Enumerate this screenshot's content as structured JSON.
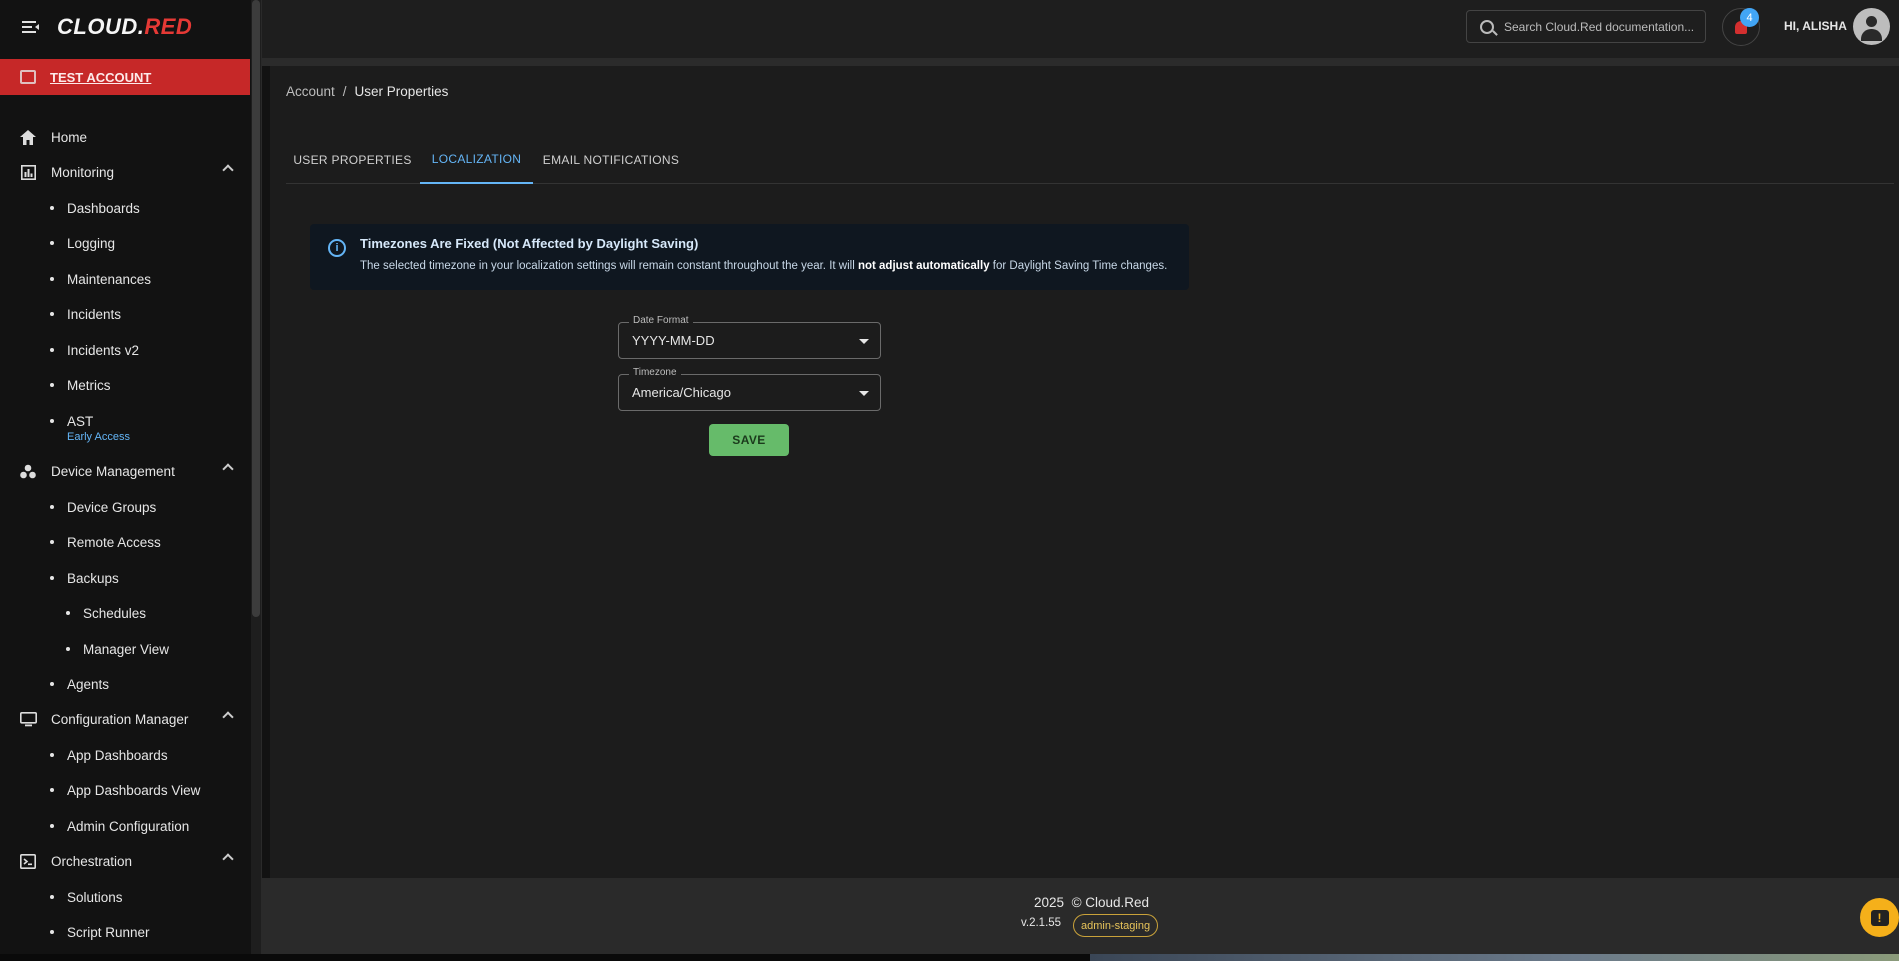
{
  "app": {
    "logo_text": "CL",
    "logo_o": "O",
    "logo_ud": "UD.",
    "logo_red": "RED"
  },
  "account": {
    "label": "TEST ACCOUNT"
  },
  "nav": {
    "home": "Home",
    "monitoring": "Monitoring",
    "dashboards": "Dashboards",
    "logging": "Logging",
    "maintenances": "Maintenances",
    "incidents": "Incidents",
    "incidents_v2": "Incidents v2",
    "metrics": "Metrics",
    "ast": "AST",
    "ast_badge": "Early Access",
    "device_management": "Device Management",
    "device_groups": "Device Groups",
    "remote_access": "Remote Access",
    "backups": "Backups",
    "schedules": "Schedules",
    "manager_view": "Manager View",
    "agents": "Agents",
    "configuration_manager": "Configuration Manager",
    "app_dashboards": "App Dashboards",
    "app_dashboards_view": "App Dashboards View",
    "admin_configuration": "Admin Configuration",
    "orchestration": "Orchestration",
    "solutions": "Solutions",
    "script_runner": "Script Runner"
  },
  "header": {
    "search_placeholder": "Search Cloud.Red documentation...",
    "notification_count": "4",
    "greeting": "HI, ALISHA"
  },
  "breadcrumb": {
    "parent": "Account",
    "separator": "/",
    "current": "User Properties"
  },
  "tabs": [
    "USER PROPERTIES",
    "LOCALIZATION",
    "EMAIL NOTIFICATIONS"
  ],
  "active_tab": "LOCALIZATION",
  "info": {
    "title": "Timezones Are Fixed (Not Affected by Daylight Saving)",
    "text_before": "The selected timezone in your localization settings will remain constant throughout the year. It will ",
    "text_bold": "not adjust automatically",
    "text_after": " for Daylight Saving Time changes."
  },
  "form": {
    "date_format_label": "Date Format",
    "date_format_value": "YYYY-MM-DD",
    "timezone_label": "Timezone",
    "timezone_value": "America/Chicago",
    "save_label": "SAVE"
  },
  "footer": {
    "year": "2025",
    "copyright": "© Cloud.Red",
    "version": "v.2.1.55",
    "environment": "admin-staging"
  },
  "colors": {
    "accent": "#64b5f6",
    "account_bar": "#c62828",
    "save_button": "#66bb6a",
    "env_badge": "#e6c35a"
  }
}
